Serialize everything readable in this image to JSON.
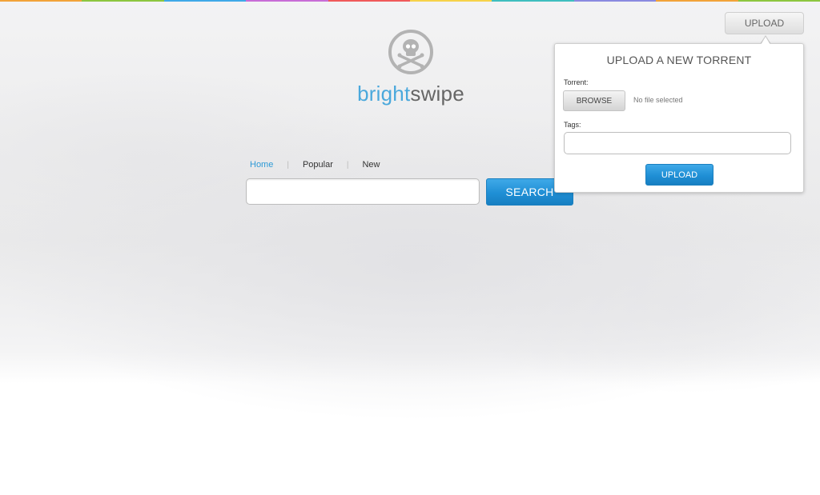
{
  "brand": {
    "name_part1": "bright",
    "name_part2": "swipe",
    "logo_icon": "skull-crossbones-icon",
    "colors": {
      "part1": "#4aa8dc",
      "part2": "#666666",
      "icon": "#b3b3b3"
    }
  },
  "rainbow_colors": [
    "#f2a33a",
    "#8cc63f",
    "#3fa9e8",
    "#c86dd7",
    "#f05a5a",
    "#f7d34a",
    "#3fbfbf",
    "#8a8ae0",
    "#f2a33a",
    "#8cc63f"
  ],
  "nav": {
    "items": [
      {
        "label": "Home",
        "active": true
      },
      {
        "label": "Popular",
        "active": false
      },
      {
        "label": "New",
        "active": false
      }
    ],
    "separator": "|"
  },
  "search": {
    "value": "",
    "placeholder": "",
    "button_label": "SEARCH",
    "accent": "#1f8fd5"
  },
  "header": {
    "upload_label": "UPLOAD"
  },
  "upload_panel": {
    "title": "UPLOAD A NEW TORRENT",
    "torrent_label": "Torrent:",
    "browse_label": "BROWSE",
    "file_status": "No file selected",
    "tags_label": "Tags:",
    "tags_value": "",
    "submit_label": "UPLOAD"
  }
}
